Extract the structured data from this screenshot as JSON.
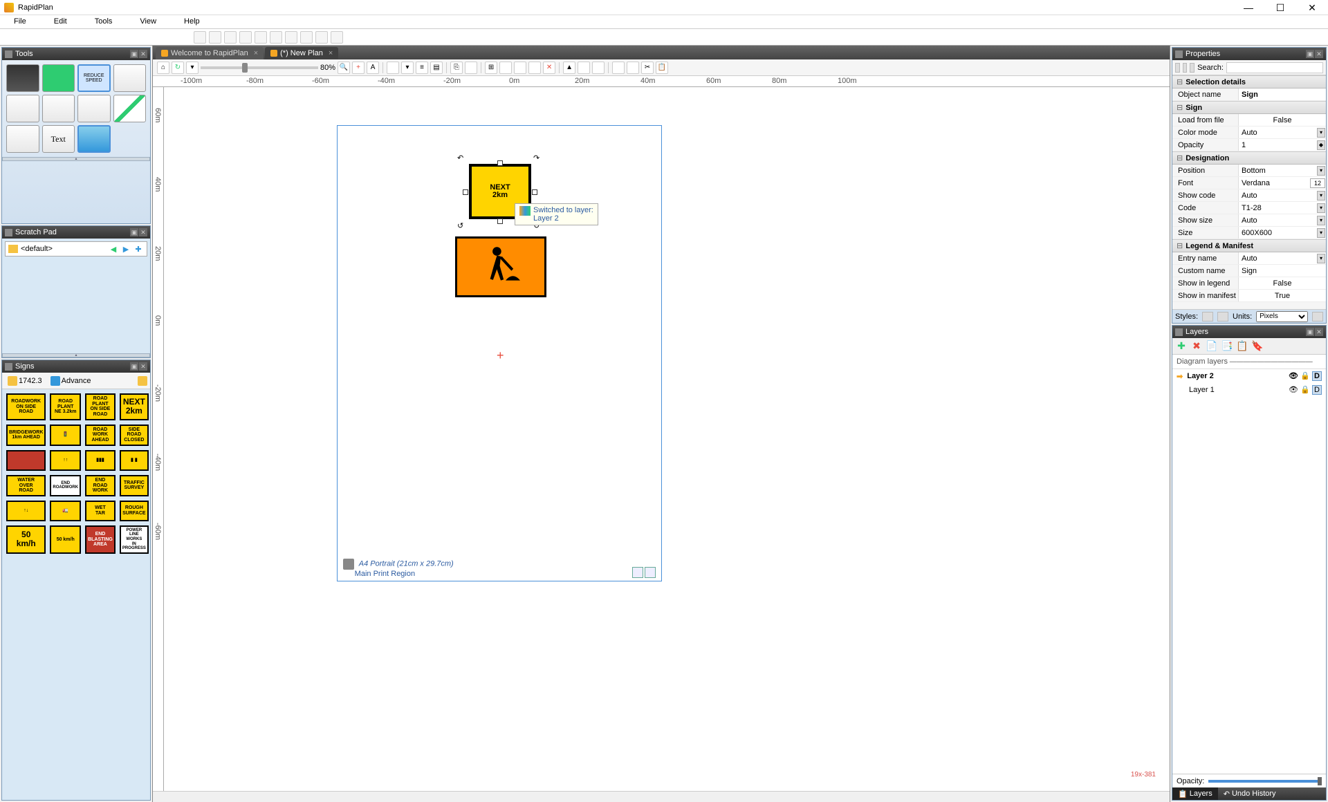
{
  "app": {
    "title": "RapidPlan"
  },
  "menus": [
    "File",
    "Edit",
    "Tools",
    "View",
    "Help"
  ],
  "tabs": [
    {
      "label": "Welcome to RapidPlan",
      "active": false
    },
    {
      "label": "(*) New Plan",
      "active": true
    }
  ],
  "zoom": "80%",
  "ruler_h": [
    "-100m",
    "-80m",
    "-60m",
    "-40m",
    "-20m",
    "0m",
    "20m",
    "40m",
    "60m",
    "80m",
    "100m"
  ],
  "ruler_v": [
    "60m",
    "40m",
    "20m",
    "0m",
    "-20m",
    "-40m",
    "-60m"
  ],
  "panels": {
    "tools": "Tools",
    "scratch": "Scratch Pad",
    "signs": "Signs",
    "properties": "Properties",
    "layers": "Layers"
  },
  "scratch_default": "<default>",
  "signs_bar": {
    "count": "1742.3",
    "filter": "Advance"
  },
  "signs_grid": [
    {
      "t": "ROADWORK\nON SIDE ROAD",
      "c": "y"
    },
    {
      "t": "ROAD PLANT\nNE 3.2km",
      "c": "y"
    },
    {
      "t": "ROAD PLANT\nON SIDE ROAD",
      "c": "y"
    },
    {
      "t": "NEXT\n2km",
      "c": "y",
      "big": true
    },
    {
      "t": "BRIDGEWORK\n1km AHEAD",
      "c": "y"
    },
    {
      "t": "🚦",
      "c": "y"
    },
    {
      "t": "ROAD\nWORK\nAHEAD",
      "c": "y"
    },
    {
      "t": "SIDE ROAD\nCLOSED",
      "c": "y"
    },
    {
      "t": "",
      "c": "r"
    },
    {
      "t": "↑↑",
      "c": "y"
    },
    {
      "t": "▮▮▮",
      "c": "y"
    },
    {
      "t": "▮ ▮",
      "c": "y"
    },
    {
      "t": "WATER\nOVER\nROAD",
      "c": "y"
    },
    {
      "t": "END\nROADWORK",
      "c": "w"
    },
    {
      "t": "END\nROAD\nWORK",
      "c": "y"
    },
    {
      "t": "TRAFFIC\nSURVEY",
      "c": "y"
    },
    {
      "t": "↑↓",
      "c": "y"
    },
    {
      "t": "🚛",
      "c": "y"
    },
    {
      "t": "WET\nTAR",
      "c": "y"
    },
    {
      "t": "ROUGH\nSURFACE",
      "c": "y"
    },
    {
      "t": "50\nkm/h",
      "c": "y",
      "big": true
    },
    {
      "t": "50 km/h",
      "c": "y"
    },
    {
      "t": "END\nBLASTING AREA",
      "c": "r"
    },
    {
      "t": "POWER LINE\nWORKS\nIN PROGRESS",
      "c": "w"
    }
  ],
  "canvas": {
    "sign_next_line1": "NEXT",
    "sign_next_line2": "2km",
    "tooltip_line1": "Switched to layer:",
    "tooltip_line2": "Layer 2",
    "page_size": "A4 Portrait (21cm x 29.7cm)",
    "page_region": "Main Print Region",
    "coord": "19x-381"
  },
  "properties": {
    "search_label": "Search:",
    "sections": {
      "selection": "Selection details",
      "sign": "Sign",
      "designation": "Designation",
      "legend": "Legend & Manifest"
    },
    "rows": {
      "object_name_label": "Object name",
      "object_name": "Sign",
      "load_from_file_label": "Load from file",
      "load_from_file": "False",
      "color_mode_label": "Color mode",
      "color_mode": "Auto",
      "opacity_label": "Opacity",
      "opacity": "1",
      "position_label": "Position",
      "position": "Bottom",
      "font_label": "Font",
      "font": "Verdana",
      "font_size": "12",
      "show_code_label": "Show code",
      "show_code": "Auto",
      "code_label": "Code",
      "code": "T1-28",
      "show_size_label": "Show size",
      "show_size": "Auto",
      "size_label": "Size",
      "size": "600X600",
      "entry_name_label": "Entry name",
      "entry_name": "Auto",
      "custom_name_label": "Custom name",
      "custom_name": "Sign",
      "show_legend_label": "Show in legend",
      "show_legend": "False",
      "show_manifest_label": "Show in manifest",
      "show_manifest": "True"
    },
    "footer": {
      "styles": "Styles:",
      "units_label": "Units:",
      "units": "Pixels"
    }
  },
  "layers": {
    "section": "Diagram layers",
    "items": [
      {
        "name": "Layer 2",
        "active": true
      },
      {
        "name": "Layer 1",
        "active": false
      }
    ],
    "opacity_label": "Opacity:",
    "bottom_tabs": [
      "Layers",
      "Undo History"
    ]
  }
}
